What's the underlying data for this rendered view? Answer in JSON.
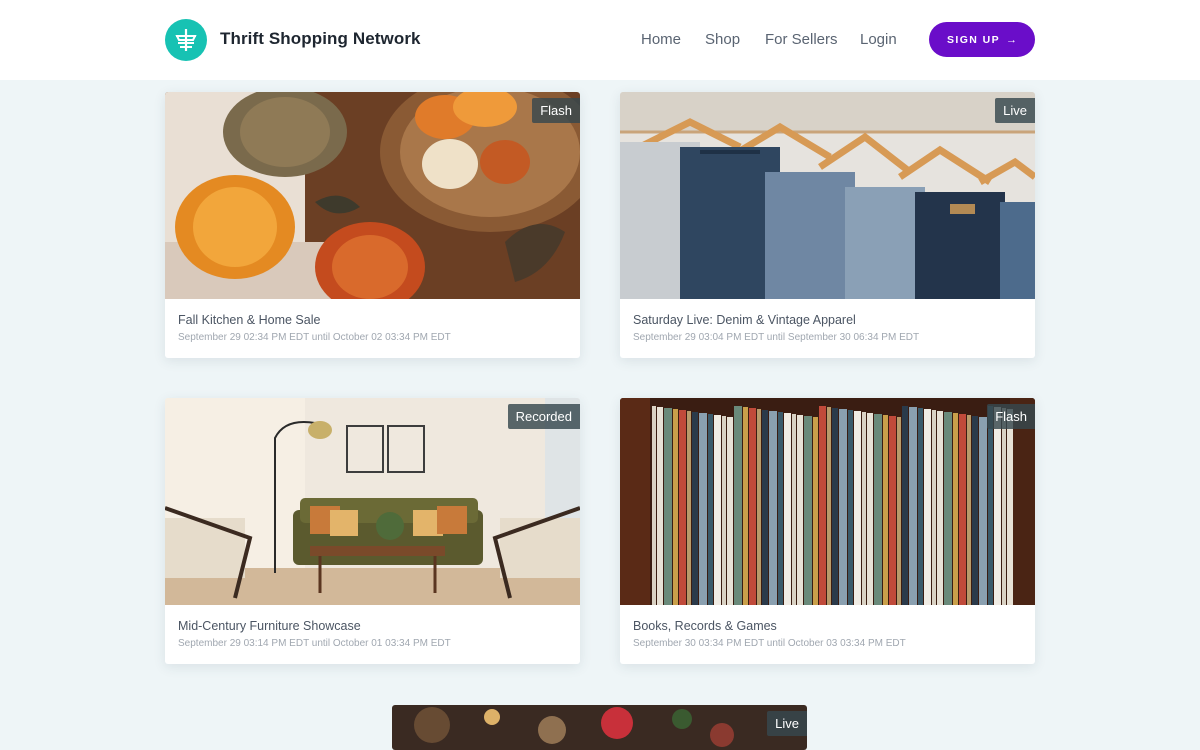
{
  "header": {
    "brand": "Thrift Shopping Network",
    "logo_icon": "shopping-basket-icon",
    "nav": [
      {
        "label": "Home"
      },
      {
        "label": "Shop"
      },
      {
        "label": "For Sellers"
      },
      {
        "label": "Login"
      }
    ],
    "signup_label": "SIGN UP",
    "signup_arrow": "→"
  },
  "colors": {
    "accent": "#6a0dc9",
    "logo": "#17c2b3",
    "background": "#eef5f7",
    "badge": "#37484e"
  },
  "events": [
    {
      "badge": "Flash",
      "title": "Fall Kitchen & Home Sale",
      "dates": "September 29 02:34 PM EDT until October 02 03:34 PM EDT",
      "image": "pumpkins-photo"
    },
    {
      "badge": "Live",
      "title": "Saturday Live: Denim & Vintage Apparel",
      "dates": "September 29 03:04 PM EDT until September 30 06:34 PM EDT",
      "image": "denim-hangers-photo"
    },
    {
      "badge": "Recorded",
      "title": "Mid-Century Furniture Showcase",
      "dates": "September 29 03:14 PM EDT until October 01 03:34 PM EDT",
      "image": "living-room-photo"
    },
    {
      "badge": "Flash",
      "title": "Books, Records & Games",
      "dates": "September 30 03:34 PM EDT until October 03 03:34 PM EDT",
      "image": "records-shelf-photo"
    },
    {
      "badge": "Live",
      "image": "holiday-lights-photo"
    }
  ]
}
